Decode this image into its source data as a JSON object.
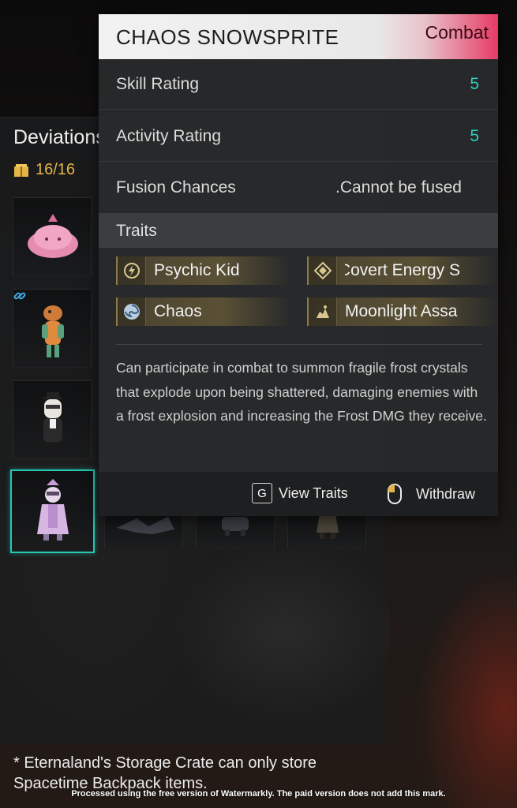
{
  "storage": {
    "title": "Deviations",
    "capacity": "16/16",
    "footnote": "* Eternaland's Storage Crate can only store Spacetime Backpack items."
  },
  "deviation_card": {
    "name": "CHAOS SNOWSPRITE",
    "tag": "Combat",
    "stats": [
      {
        "label": "Skill Rating",
        "value": "5"
      },
      {
        "label": "Activity Rating",
        "value": "5"
      }
    ],
    "fusion": {
      "label": "Fusion Chances",
      "value": "Cannot be fused."
    },
    "traits_label": "Traits",
    "traits": [
      {
        "label": "Psychic Kid",
        "icon": "psychic-kid-icon"
      },
      {
        "label": "Covert Energy S",
        "icon": "covert-energy-icon"
      },
      {
        "label": "Chaos",
        "icon": "chaos-swirl-icon"
      },
      {
        "label": "Moonlight Assa",
        "icon": "moonlight-assassin-icon"
      }
    ],
    "description": "Can participate in combat to summon fragile frost crystals that explode upon being shattered, damaging enemies with a frost explosion and increasing the Frost DMG they receive.",
    "actions": {
      "view_traits_key": "G",
      "view_traits": "View Traits",
      "withdraw": "Withdraw"
    }
  },
  "watermark": "Processed using the free version of Watermarkly. The paid version does not add this mark.",
  "colors": {
    "accent_teal": "#27c7b4",
    "capacity_gold": "#e3b546",
    "combat_tag": "#e63a66"
  }
}
